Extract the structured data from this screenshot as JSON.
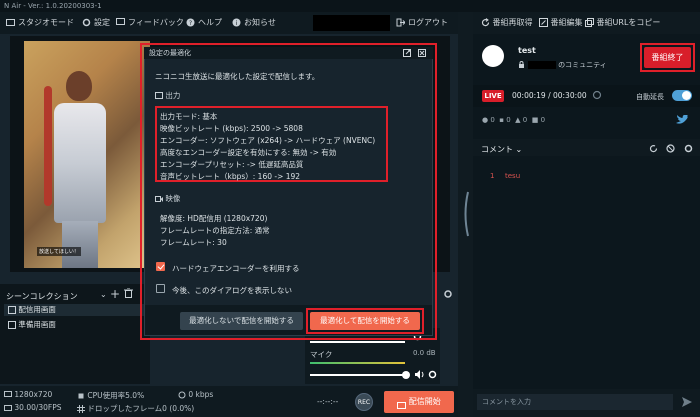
{
  "window": {
    "title": "N Air - Ver.: 1.0.20200303-1"
  },
  "menu": {
    "studio_mode": "スタジオモード",
    "settings": "設定",
    "feedback": "フィードバック",
    "help": "ヘルプ",
    "notice": "お知らせ",
    "logout": "ログアウト"
  },
  "preview": {
    "overlay_text": "放送してほしい！"
  },
  "scenes": {
    "title": "シーンコレクション",
    "items": [
      "配信用画面",
      "準備用画面"
    ]
  },
  "mixer": {
    "mic_label": "マイク",
    "mic_level": "0.0 dB"
  },
  "status": {
    "resolution": "1280x720",
    "cpu": "CPU使用率5.0%",
    "bitrate": "0 kbps",
    "fps": "30.00/30FPS",
    "dropped": "ドロップしたフレーム0 (0.0%)",
    "time": "--:--:--",
    "rec_label": "REC",
    "start_label": "配信開始"
  },
  "right": {
    "menu": {
      "refresh": "番組再取得",
      "edit": "番組編集",
      "copy_url": "番組URLをコピー"
    },
    "user": {
      "name": "test",
      "community_suffix": "のコミュニティ"
    },
    "end_label": "番組終了",
    "live_badge": "LIVE",
    "elapsed": "00:00:19 / 00:30:00",
    "auto_extend": "自動延長",
    "stats": [
      "0",
      "0",
      "0",
      "0"
    ],
    "comments_label": "コメント",
    "comment": {
      "no": "1",
      "text": "tesu"
    },
    "comment_placeholder": "コメントを入力"
  },
  "dialog": {
    "title": "設定の最適化",
    "intro": "ニコニコ生放送に最適化した設定で配信します。",
    "output_header": "出力",
    "output_lines": [
      "出力モード: 基本",
      "映像ビットレート (kbps): 2500 -> 5808",
      "エンコーダー: ソフトウェア (x264) -> ハードウェア (NVENC)",
      "高度なエンコーダー設定を有効にする: 無効 -> 有効",
      "エンコーダープリセット: -> 低遅延高品質",
      "音声ビットレート（kbps）: 160 -> 192"
    ],
    "video_header": "映像",
    "video_lines": [
      "解像度: HD配信用 (1280x720)",
      "フレームレートの指定方法: 通常",
      "フレームレート: 30"
    ],
    "check_hw": "ハードウェアエンコーダーを利用する",
    "check_hide": "今後、このダイアログを表示しない",
    "btn_no_opt": "最適化しないで配信を開始する",
    "btn_opt": "最適化して配信を開始する"
  }
}
